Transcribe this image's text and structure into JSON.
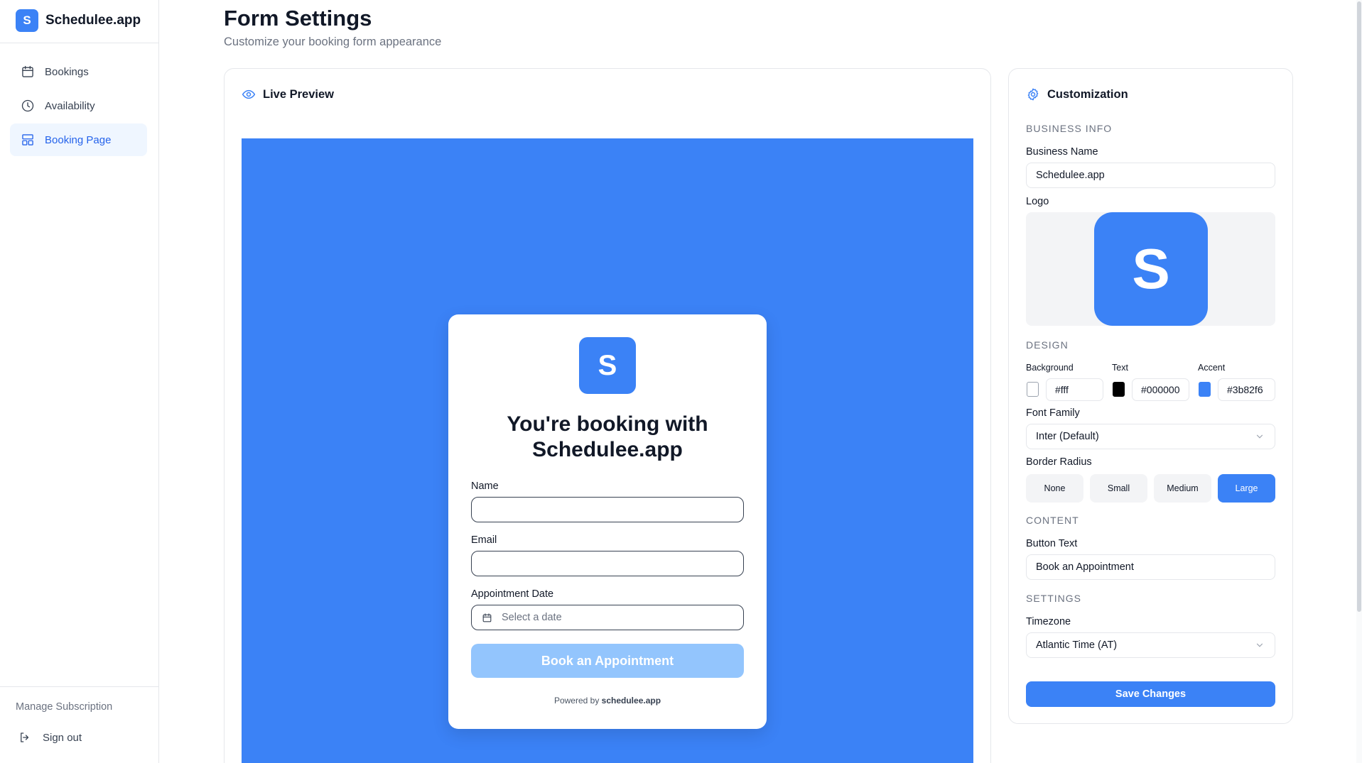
{
  "brand": {
    "logo_letter": "S",
    "name": "Schedulee.app"
  },
  "sidebar": {
    "items": [
      {
        "label": "Bookings",
        "icon": "calendar-icon"
      },
      {
        "label": "Availability",
        "icon": "clock-icon"
      },
      {
        "label": "Booking Page",
        "icon": "layout-icon",
        "active": true
      }
    ],
    "manage_subscription": "Manage Subscription",
    "sign_out": "Sign out"
  },
  "header": {
    "title": "Form Settings",
    "subtitle": "Customize your booking form appearance"
  },
  "preview": {
    "heading": "Live Preview",
    "background_color": "#3b82f6",
    "card": {
      "logo_letter": "S",
      "title_line1": "You're booking with",
      "title_line2": "Schedulee.app",
      "name_label": "Name",
      "email_label": "Email",
      "date_label": "Appointment Date",
      "date_placeholder": "Select a date",
      "button_label": "Book an Appointment",
      "powered_prefix": "Powered by",
      "powered_brand": "schedulee.app"
    }
  },
  "customization": {
    "heading": "Customization",
    "business_info": {
      "section_label": "BUSINESS INFO",
      "business_name_label": "Business Name",
      "business_name_value": "Schedulee.app",
      "logo_label": "Logo",
      "logo_letter": "S"
    },
    "design": {
      "section_label": "DESIGN",
      "background_label": "Background",
      "background_value": "#fff",
      "text_label": "Text",
      "text_value": "#000000",
      "accent_label": "Accent",
      "accent_value": "#3b82f6",
      "font_family_label": "Font Family",
      "font_family_value": "Inter (Default)",
      "border_radius_label": "Border Radius",
      "radius_options": [
        "None",
        "Small",
        "Medium",
        "Large"
      ],
      "radius_selected": "Large"
    },
    "content": {
      "section_label": "CONTENT",
      "button_text_label": "Button Text",
      "button_text_value": "Book an Appointment"
    },
    "settings": {
      "section_label": "SETTINGS",
      "timezone_label": "Timezone",
      "timezone_value": "Atlantic Time (AT)"
    },
    "save_label": "Save Changes"
  },
  "colors": {
    "accent": "#3b82f6",
    "button_disabled": "#93c5fd",
    "active_nav_bg": "#eff6ff",
    "active_nav_text": "#2563eb"
  }
}
